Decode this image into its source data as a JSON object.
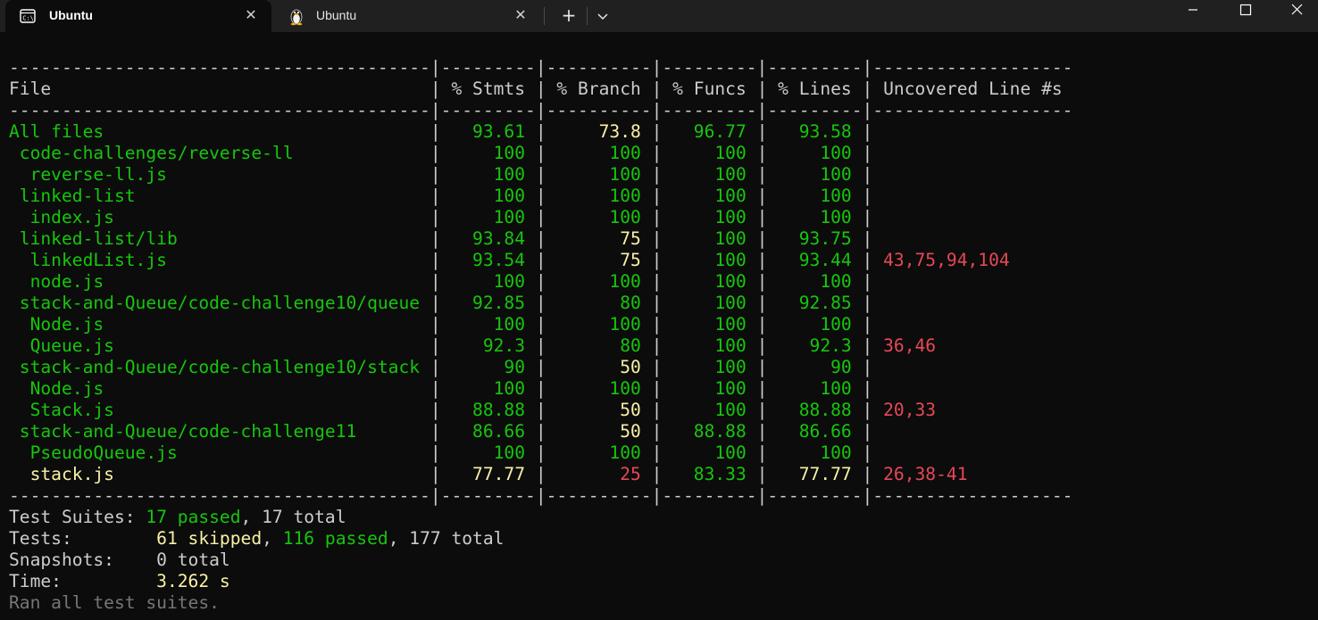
{
  "tabs": [
    {
      "title": "Ubuntu",
      "icon": "terminal-icon",
      "active": true
    },
    {
      "title": "Ubuntu",
      "icon": "linux-penguin-icon",
      "active": false
    }
  ],
  "window_buttons": [
    "minimize-icon",
    "maximize-icon",
    "close-icon"
  ],
  "colors": {
    "background": "#0c0c0c",
    "titlebar": "#202020",
    "green": "#16c60c",
    "yellow": "#f9f1a5",
    "red": "#e74856",
    "text": "#cccccc"
  },
  "coverage": {
    "separator": "----------------------------------------|---------|----------|---------|---------|-------------------",
    "headers": [
      "File",
      "% Stmts",
      "% Branch",
      "% Funcs",
      "% Lines",
      "Uncovered Line #s"
    ],
    "rows": [
      {
        "file": "All files",
        "indent": 0,
        "stmts": "93.61",
        "branch": "73.8",
        "funcs": "96.77",
        "lines": "93.58",
        "uncovered": "",
        "file_color": "green",
        "stmts_color": "green",
        "branch_color": "yellow",
        "funcs_color": "green",
        "lines_color": "green"
      },
      {
        "file": "code-challenges/reverse-ll",
        "indent": 1,
        "stmts": "100",
        "branch": "100",
        "funcs": "100",
        "lines": "100",
        "uncovered": "",
        "file_color": "green",
        "stmts_color": "green",
        "branch_color": "green",
        "funcs_color": "green",
        "lines_color": "green"
      },
      {
        "file": "reverse-ll.js",
        "indent": 2,
        "stmts": "100",
        "branch": "100",
        "funcs": "100",
        "lines": "100",
        "uncovered": "",
        "file_color": "green",
        "stmts_color": "green",
        "branch_color": "green",
        "funcs_color": "green",
        "lines_color": "green"
      },
      {
        "file": "linked-list",
        "indent": 1,
        "stmts": "100",
        "branch": "100",
        "funcs": "100",
        "lines": "100",
        "uncovered": "",
        "file_color": "green",
        "stmts_color": "green",
        "branch_color": "green",
        "funcs_color": "green",
        "lines_color": "green"
      },
      {
        "file": "index.js",
        "indent": 2,
        "stmts": "100",
        "branch": "100",
        "funcs": "100",
        "lines": "100",
        "uncovered": "",
        "file_color": "green",
        "stmts_color": "green",
        "branch_color": "green",
        "funcs_color": "green",
        "lines_color": "green"
      },
      {
        "file": "linked-list/lib",
        "indent": 1,
        "stmts": "93.84",
        "branch": "75",
        "funcs": "100",
        "lines": "93.75",
        "uncovered": "",
        "file_color": "green",
        "stmts_color": "green",
        "branch_color": "yellow",
        "funcs_color": "green",
        "lines_color": "green"
      },
      {
        "file": "linkedList.js",
        "indent": 2,
        "stmts": "93.54",
        "branch": "75",
        "funcs": "100",
        "lines": "93.44",
        "uncovered": "43,75,94,104",
        "file_color": "green",
        "stmts_color": "green",
        "branch_color": "yellow",
        "funcs_color": "green",
        "lines_color": "green"
      },
      {
        "file": "node.js",
        "indent": 2,
        "stmts": "100",
        "branch": "100",
        "funcs": "100",
        "lines": "100",
        "uncovered": "",
        "file_color": "green",
        "stmts_color": "green",
        "branch_color": "green",
        "funcs_color": "green",
        "lines_color": "green"
      },
      {
        "file": "stack-and-Queue/code-challenge10/queue",
        "indent": 1,
        "stmts": "92.85",
        "branch": "80",
        "funcs": "100",
        "lines": "92.85",
        "uncovered": "",
        "file_color": "green",
        "stmts_color": "green",
        "branch_color": "green",
        "funcs_color": "green",
        "lines_color": "green"
      },
      {
        "file": "Node.js",
        "indent": 2,
        "stmts": "100",
        "branch": "100",
        "funcs": "100",
        "lines": "100",
        "uncovered": "",
        "file_color": "green",
        "stmts_color": "green",
        "branch_color": "green",
        "funcs_color": "green",
        "lines_color": "green"
      },
      {
        "file": "Queue.js",
        "indent": 2,
        "stmts": "92.3",
        "branch": "80",
        "funcs": "100",
        "lines": "92.3",
        "uncovered": "36,46",
        "file_color": "green",
        "stmts_color": "green",
        "branch_color": "green",
        "funcs_color": "green",
        "lines_color": "green"
      },
      {
        "file": "stack-and-Queue/code-challenge10/stack",
        "indent": 1,
        "stmts": "90",
        "branch": "50",
        "funcs": "100",
        "lines": "90",
        "uncovered": "",
        "file_color": "green",
        "stmts_color": "green",
        "branch_color": "yellow",
        "funcs_color": "green",
        "lines_color": "green"
      },
      {
        "file": "Node.js",
        "indent": 2,
        "stmts": "100",
        "branch": "100",
        "funcs": "100",
        "lines": "100",
        "uncovered": "",
        "file_color": "green",
        "stmts_color": "green",
        "branch_color": "green",
        "funcs_color": "green",
        "lines_color": "green"
      },
      {
        "file": "Stack.js",
        "indent": 2,
        "stmts": "88.88",
        "branch": "50",
        "funcs": "100",
        "lines": "88.88",
        "uncovered": "20,33",
        "file_color": "green",
        "stmts_color": "green",
        "branch_color": "yellow",
        "funcs_color": "green",
        "lines_color": "green"
      },
      {
        "file": "stack-and-Queue/code-challenge11",
        "indent": 1,
        "stmts": "86.66",
        "branch": "50",
        "funcs": "88.88",
        "lines": "86.66",
        "uncovered": "",
        "file_color": "green",
        "stmts_color": "green",
        "branch_color": "yellow",
        "funcs_color": "green",
        "lines_color": "green"
      },
      {
        "file": "PseudoQueue.js",
        "indent": 2,
        "stmts": "100",
        "branch": "100",
        "funcs": "100",
        "lines": "100",
        "uncovered": "",
        "file_color": "green",
        "stmts_color": "green",
        "branch_color": "green",
        "funcs_color": "green",
        "lines_color": "green"
      },
      {
        "file": "stack.js",
        "indent": 2,
        "stmts": "77.77",
        "branch": "25",
        "funcs": "83.33",
        "lines": "77.77",
        "uncovered": "26,38-41",
        "file_color": "yellow",
        "stmts_color": "yellow",
        "branch_color": "red",
        "funcs_color": "green",
        "lines_color": "yellow"
      }
    ]
  },
  "summary": {
    "test_suites_label": "Test Suites:",
    "test_suites_passed": "17 passed",
    "test_suites_total": "17 total",
    "tests_label": "Tests:",
    "tests_skipped": "61 skipped",
    "tests_passed": "116 passed",
    "tests_total": "177 total",
    "snapshots_label": "Snapshots:",
    "snapshots_total": "0 total",
    "time_label": "Time:",
    "time_value": "3.262 s",
    "ran_all": "Ran all test suites."
  }
}
